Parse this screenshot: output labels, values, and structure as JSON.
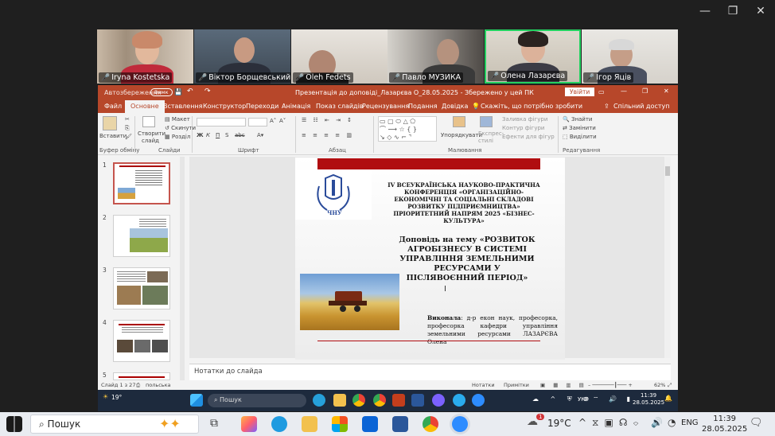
{
  "window": {
    "minimize": "—",
    "restore": "❐",
    "close": "✕"
  },
  "participants": [
    {
      "name": "Iryna Kostetska"
    },
    {
      "name": "Віктор Борщевський"
    },
    {
      "name": "Oleh Fedets"
    },
    {
      "name": "Павло МУЗИКА"
    },
    {
      "name": "Олена Лазарєва"
    },
    {
      "name": "Ігор Яців"
    }
  ],
  "ppt": {
    "autosave": "Автозбереження",
    "autosave_state": "Вимк",
    "doc_title": "Презентація до доповіді_Лазарєва О_28.05.2025 - Збережено у цей ПК",
    "signin": "Увійти",
    "tabs": [
      "Файл",
      "Основне",
      "Вставлення",
      "Конструктор",
      "Переходи",
      "Анімація",
      "Показ слайдів",
      "Рецензування",
      "Подання",
      "Довідка"
    ],
    "tell_me": "Скажіть, що потрібно зробити",
    "share": "Спільний доступ",
    "ribbon": {
      "paste": "Вставити",
      "new_slide": "Створити слайд",
      "layout": "Макет",
      "reset": "Скинути",
      "sections": "Розділ",
      "arrange": "Упорядкувати",
      "quick_styles": "Експрес-стилі",
      "shape_fill": "Заливка фігури",
      "shape_outline": "Контур фігури",
      "shape_effects": "Ефекти для фігур",
      "find": "Знайти",
      "replace": "Замінити",
      "select": "Виділити",
      "groups": {
        "clipboard": "Буфер обміну",
        "slides": "Слайди",
        "font": "Шрифт",
        "paragraph": "Абзац",
        "drawing": "Малювання",
        "editing": "Редагування"
      },
      "font_buttons": [
        "Ж",
        "К",
        "П",
        "S",
        "abc"
      ],
      "font_size_buttons": [
        "A˄",
        "A˅"
      ]
    },
    "thumb_numbers": [
      "1",
      "2",
      "3",
      "4",
      "5"
    ],
    "slide": {
      "logo_text": "ЧНУ",
      "conf_title": "IV ВСЕУКРАЇНСЬКА НАУКОВО-ПРАКТИЧНА КОНФЕРЕНЦІЯ «ОРГАНІЗАЦІЙНО-ЕКОНОМІЧНІ ТА СОЦІАЛЬНІ СКЛАДОВІ РОЗВИТКУ ПІДПРИЄМНИЦТВА» ПРІОРИТЕТНИЙ НАПРЯМ 2025 «БІЗНЕС-КУЛЬТУРА»",
      "report_title": "Доповідь на тему «РОЗВИТОК АГРОБІЗНЕСУ В СИСТЕМІ УПРАВЛІННЯ ЗЕМЕЛЬНИМИ РЕСУРСАМИ У ПІСЛЯВОЄННИЙ ПЕРІОД»",
      "author_label": "Виконала",
      "author_text": ": д-р екон наук, професорка, професорка кафедри управління земельними ресурсами ЛАЗАРЄВА Олена"
    },
    "notes_placeholder": "Нотатки до слайда",
    "status": {
      "slide_of": "Слайд 1 з 27",
      "language": "польська",
      "notes": "Нотатки",
      "comments": "Примітки",
      "zoom": "62%"
    }
  },
  "inner_taskbar": {
    "temp": "19°",
    "search": "Пошук",
    "lang": "УКР",
    "time": "11:39",
    "date": "28.05.2025"
  },
  "taskbar": {
    "search": "Пошук",
    "temp": "19°C",
    "lang": "ENG",
    "time": "11:39",
    "date": "28.05.2025",
    "weather_badge": "1"
  }
}
